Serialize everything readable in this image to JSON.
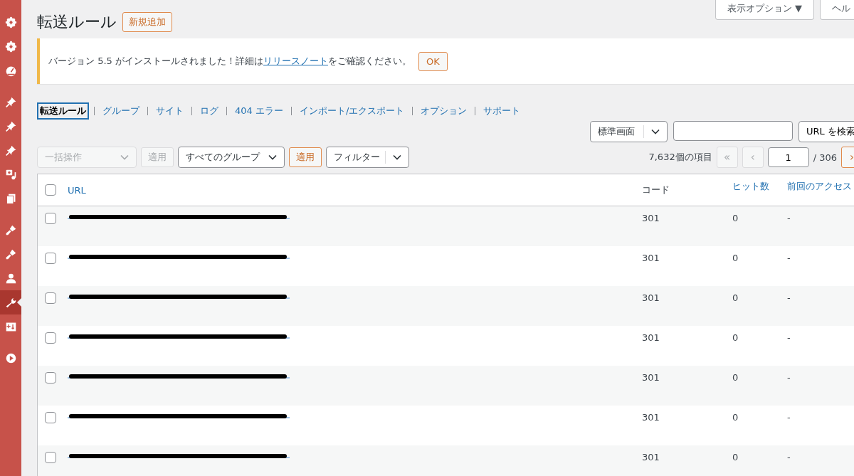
{
  "sidebar": {
    "items": [
      {
        "kind": "gear",
        "selected": false
      },
      {
        "kind": "gear",
        "selected": false
      },
      {
        "kind": "gauge",
        "selected": false
      },
      {
        "kind": "pin",
        "selected": false
      },
      {
        "kind": "pin",
        "selected": false
      },
      {
        "kind": "pin",
        "selected": false
      },
      {
        "kind": "media",
        "selected": false
      },
      {
        "kind": "pages",
        "selected": false
      },
      {
        "kind": "brush",
        "selected": false
      },
      {
        "kind": "brush",
        "selected": false
      },
      {
        "kind": "user",
        "selected": false
      },
      {
        "kind": "wrench",
        "selected": true
      },
      {
        "kind": "plusbox",
        "selected": false
      },
      {
        "kind": "play",
        "selected": false
      }
    ]
  },
  "screen_options": [
    "表示オプション ▼",
    "ヘル"
  ],
  "title": "転送ルール",
  "add_new": "新規追加",
  "notice": {
    "text": "バージョン 5.5 がインストールされました！詳細は",
    "link": "リリースノート",
    "after": "をご確認ください。",
    "button": "OK"
  },
  "tabs": [
    {
      "label": "転送ルール",
      "selected": true
    },
    {
      "label": "グループ",
      "selected": false
    },
    {
      "label": "サイト",
      "selected": false
    },
    {
      "label": "ログ",
      "selected": false
    },
    {
      "label": "404 エラー",
      "selected": false
    },
    {
      "label": "インポート/エクスポート",
      "selected": false
    },
    {
      "label": "オプション",
      "selected": false
    },
    {
      "label": "サポート",
      "selected": false
    }
  ],
  "search": {
    "mode": "標準画面",
    "button": "URL を検索"
  },
  "bulk": {
    "label": "一括操作",
    "disabled": true,
    "apply": "適用"
  },
  "group_filter": {
    "label": "すべてのグループ",
    "apply": "適用"
  },
  "filter": "フィルター",
  "pagination": {
    "count": "7,632個の項目",
    "first": "«",
    "prev": "‹",
    "page": "1",
    "total": "/ 306",
    "next": "›"
  },
  "table": {
    "select_all_checked": false,
    "columns": [
      "URL",
      "コード",
      "ヒット数",
      "前回のアクセス"
    ],
    "rows": [
      {
        "checked": false,
        "code": "301",
        "hits": "0",
        "last": "-"
      },
      {
        "checked": false,
        "code": "301",
        "hits": "0",
        "last": "-"
      },
      {
        "checked": false,
        "code": "301",
        "hits": "0",
        "last": "-"
      },
      {
        "checked": false,
        "code": "301",
        "hits": "0",
        "last": "-"
      },
      {
        "checked": false,
        "code": "301",
        "hits": "0",
        "last": "-"
      },
      {
        "checked": false,
        "code": "301",
        "hits": "0",
        "last": "-"
      },
      {
        "checked": false,
        "code": "301",
        "hits": "0",
        "last": "-"
      }
    ]
  }
}
